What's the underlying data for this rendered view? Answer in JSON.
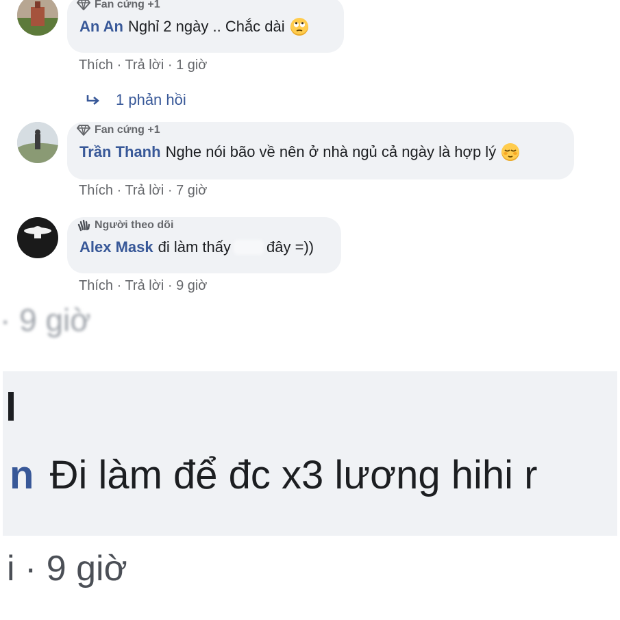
{
  "comments": [
    {
      "badge": "Fan cứng +1",
      "badge_icon": "diamond-icon",
      "author": "An An",
      "text": "Nghỉ 2 ngày .. Chắc dài",
      "emoji": "rolling-eyes-emoji",
      "like": "Thích",
      "reply": "Trả lời",
      "time": "1 giờ"
    },
    {
      "badge": "Fan cứng +1",
      "badge_icon": "diamond-icon",
      "author": "Trần Thanh",
      "text": "Nghe nói bão về nên ở nhà ngủ cả ngày là hợp lý",
      "emoji": "relieved-emoji",
      "like": "Thích",
      "reply": "Trả lời",
      "time": "7 giờ"
    },
    {
      "badge": "Người theo dõi",
      "badge_icon": "waving-hand-icon",
      "author": "Alex Mask",
      "text_before": "đi làm thấy",
      "text_after": "đây =))",
      "like": "Thích",
      "reply": "Trả lời",
      "time": "9 giờ"
    }
  ],
  "replies_link": "1 phản hồi",
  "zoomed": {
    "author_tail": "n",
    "text": "Đi làm để đc x3 lương hihi r",
    "actions": "i · 9 giờ"
  },
  "colors": {
    "author": "#385898",
    "bubble": "#f0f2f5",
    "meta": "#65676b"
  }
}
